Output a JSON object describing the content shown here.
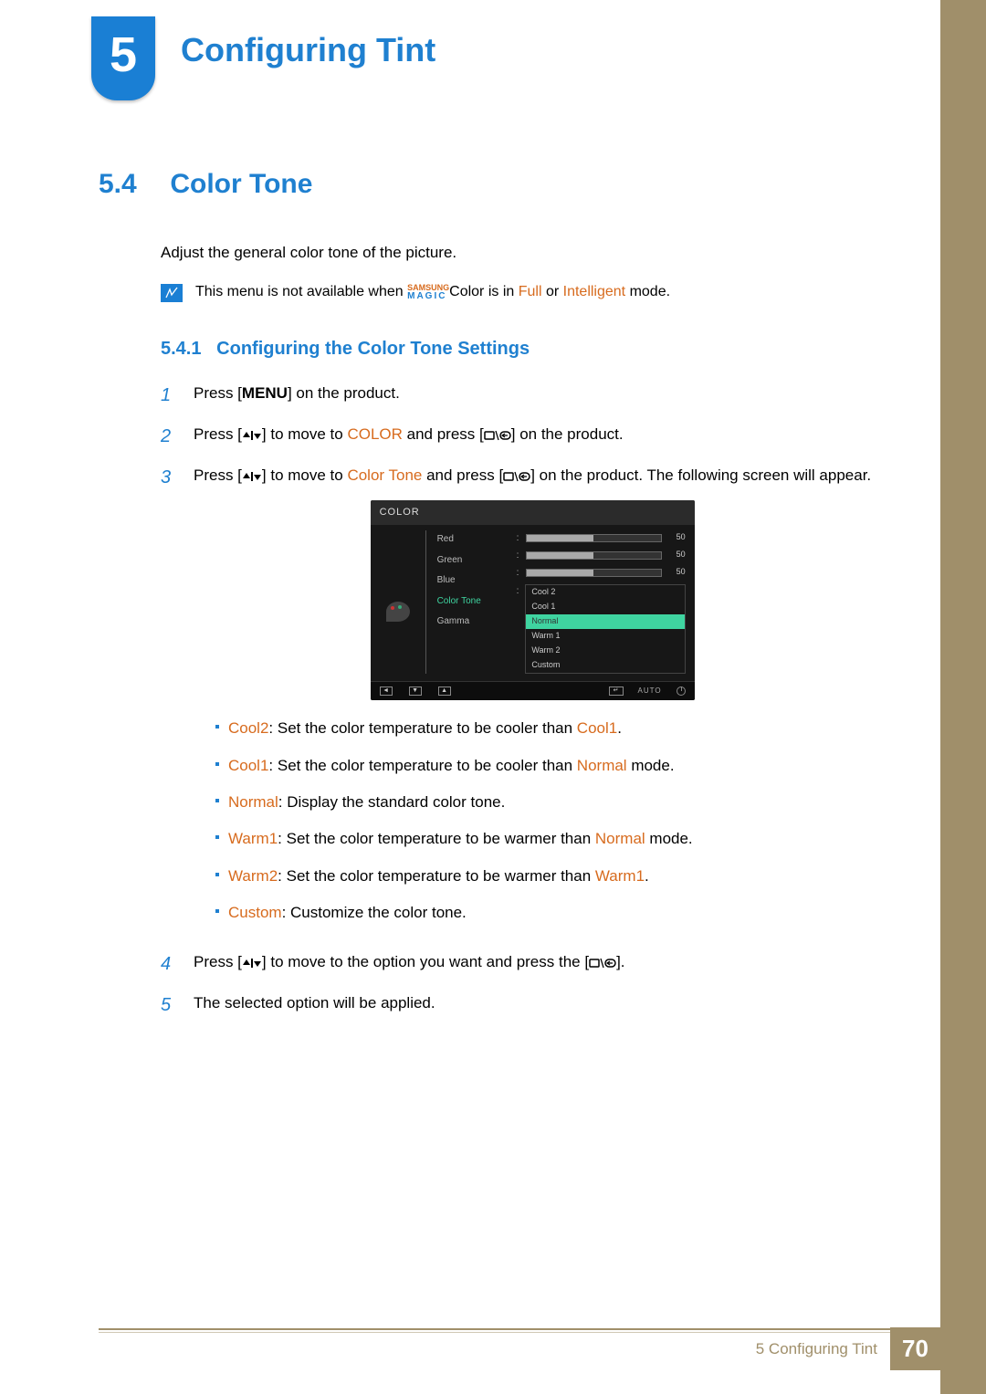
{
  "chapter": {
    "number": "5",
    "title": "Configuring Tint"
  },
  "section": {
    "number": "5.4",
    "title": "Color Tone"
  },
  "intro": "Adjust the general color tone of the picture.",
  "note": {
    "pre": "This menu is not available when ",
    "magic_top": "SAMSUNG",
    "magic_bot": "MAGIC",
    "colorword": "Color",
    "mid1": " is in ",
    "full": "Full",
    "mid2": " or ",
    "intelligent": "Intelligent",
    "post": " mode."
  },
  "subsection": {
    "number": "5.4.1",
    "title": "Configuring the Color Tone Settings"
  },
  "steps": {
    "s1": {
      "num": "1",
      "pre": "Press [",
      "menu": "MENU",
      "post": "] on the product."
    },
    "s2": {
      "num": "2",
      "pre": "Press [",
      "mid1": "] to move to ",
      "color": "COLOR",
      "mid2": " and press [",
      "post": "] on the product."
    },
    "s3": {
      "num": "3",
      "pre": "Press [",
      "mid1": "] to move to ",
      "ct": "Color Tone",
      "mid2": " and press [",
      "post": "] on the product. The following screen will appear."
    },
    "s4": {
      "num": "4",
      "pre": "Press [",
      "mid1": "] to move to the option you want and press the [",
      "post": "]."
    },
    "s5": {
      "num": "5",
      "text": "The selected option will be applied."
    }
  },
  "osd": {
    "title": "COLOR",
    "labels": {
      "red": "Red",
      "green": "Green",
      "blue": "Blue",
      "color_tone": "Color Tone",
      "gamma": "Gamma"
    },
    "values": {
      "red": "50",
      "green": "50",
      "blue": "50"
    },
    "options": {
      "cool2": "Cool 2",
      "cool1": "Cool 1",
      "normal": "Normal",
      "warm1": "Warm 1",
      "warm2": "Warm 2",
      "custom": "Custom"
    },
    "auto": "AUTO"
  },
  "bullets": {
    "b1": {
      "term": "Cool2",
      "desc": ": Set the color temperature to be cooler than ",
      "ref": "Cool1",
      "tail": "."
    },
    "b2": {
      "term": "Cool1",
      "desc": ": Set the color temperature to be cooler than ",
      "ref": "Normal",
      "tail": " mode."
    },
    "b3": {
      "term": "Normal",
      "desc": ": Display the standard color tone.",
      "ref": "",
      "tail": ""
    },
    "b4": {
      "term": "Warm1",
      "desc": ": Set the color temperature to be warmer than ",
      "ref": "Normal",
      "tail": " mode."
    },
    "b5": {
      "term": "Warm2",
      "desc": ": Set the color temperature to be warmer than ",
      "ref": "Warm1",
      "tail": "."
    },
    "b6": {
      "term": "Custom",
      "desc": ": Customize the color tone.",
      "ref": "",
      "tail": ""
    }
  },
  "footer": {
    "chapter": "5",
    "title": "Configuring Tint",
    "page": "70"
  }
}
